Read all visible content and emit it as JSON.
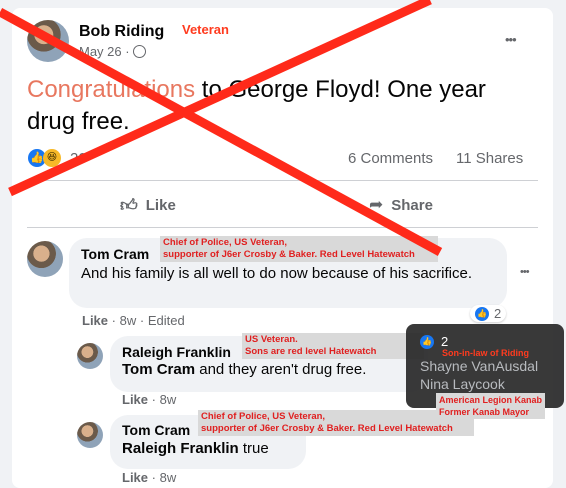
{
  "post": {
    "author": "Bob Riding",
    "author_note": "Veteran",
    "date": "May 26",
    "dot": "·",
    "more": "•••",
    "text_highlight": "Congratulations",
    "text_rest": " to George Floyd! One year drug free.",
    "reaction_count": "20",
    "comments": "6 Comments",
    "shares": "11 Shares",
    "like_label": "Like",
    "share_label": "Share"
  },
  "comments": [
    {
      "author": "Tom Cram",
      "tag": "Chief of Police, US Veteran,\nsupporter of J6er Crosby & Baker.  Red Level Hatewatch",
      "text": "And his family is all well to do now because of his sacrifice.",
      "like": "Like",
      "age": "8w",
      "edited": "Edited",
      "reaction_count": "2"
    },
    {
      "author": "Raleigh Franklin",
      "tag": "US Veteran.\nSons are red level Hatewatch",
      "mention": "Tom Cram",
      "text": " and they aren't drug free.",
      "like": "Like",
      "age": "8w"
    },
    {
      "author": "Tom Cram",
      "tag": "Chief of Police, US Veteran,\nsupporter of J6er Crosby & Baker.  Red Level Hatewatch",
      "mention": "Raleigh Franklin",
      "text": " true",
      "like": "Like",
      "age": "8w"
    }
  ],
  "tooltip": {
    "count": "2",
    "note1": "Son-in-law of Riding",
    "name1": "Shayne VanAusdal",
    "name2": "Nina Laycook",
    "note2": "American Legion Kanab\nFormer Kanab Mayor"
  },
  "colors": {
    "accent_red": "#ff2a1a",
    "facebook_blue": "#1877f2",
    "highlight_salmon": "#e8775f"
  }
}
